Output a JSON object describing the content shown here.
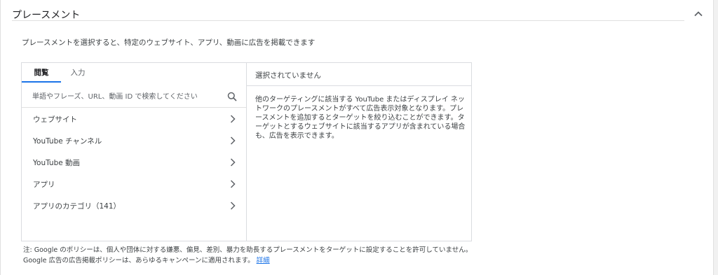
{
  "section": {
    "title": "プレースメント",
    "collapse_icon": "chevron-up-icon"
  },
  "description": "プレースメントを選択すると、特定のウェブサイト、アプリ、動画に広告を掲載できます",
  "tabs": [
    {
      "label": "閲覧",
      "active": true
    },
    {
      "label": "入力",
      "active": false
    }
  ],
  "search": {
    "placeholder": "単語やフレーズ、URL、動画 ID で検索してください",
    "value": "",
    "icon": "search-icon"
  },
  "categories": [
    {
      "label": "ウェブサイト",
      "icon": "chevron-right-icon"
    },
    {
      "label": "YouTube チャンネル",
      "icon": "chevron-right-icon"
    },
    {
      "label": "YouTube 動画",
      "icon": "chevron-right-icon"
    },
    {
      "label": "アプリ",
      "icon": "chevron-right-icon"
    },
    {
      "label": "アプリのカテゴリ（141）",
      "icon": "chevron-right-icon"
    }
  ],
  "selected_panel": {
    "header": "選択されていません",
    "body": "他のターゲティングに該当する YouTube またはディスプレイ ネットワークのプレースメントがすべて広告表示対象となります。プレースメントを追加するとターゲットを絞り込むことができます。ターゲットとするウェブサイトに該当するアプリが含まれている場合も、広告を表示できます。"
  },
  "note": {
    "line1": "注: Google のポリシーは、個人や団体に対する嫌悪、偏見、差別、暴力を助長するプレースメントをターゲットに設定することを許可していません。",
    "line2": "Google 広告の広告掲載ポリシーは、あらゆるキャンペーンに適用されます。",
    "link": "詳細"
  },
  "colors": {
    "accent": "#1a73e8",
    "border": "#dadce0",
    "text": "#3c4043"
  }
}
